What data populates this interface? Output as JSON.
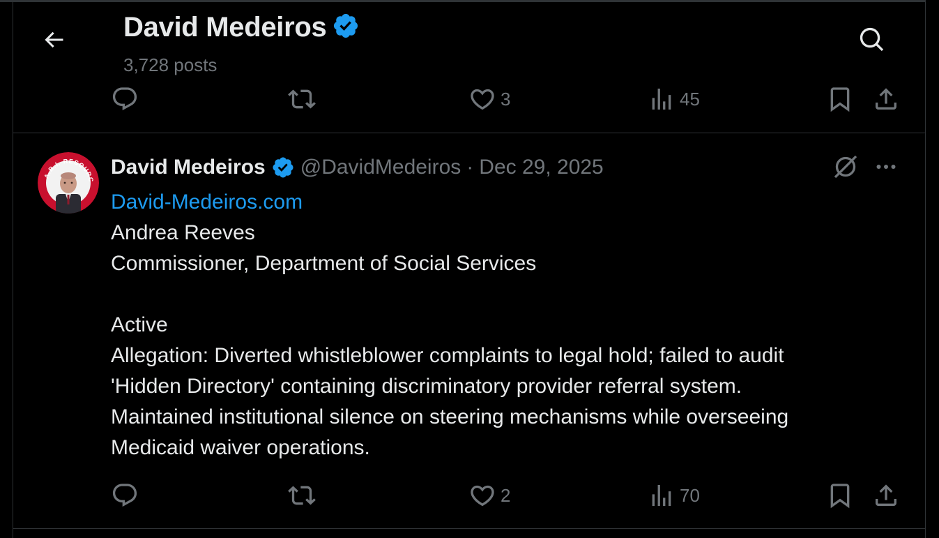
{
  "header": {
    "title": "David Medeiros",
    "posts_count": "3,728 posts"
  },
  "previous_post": {
    "actions": {
      "reply_count": "",
      "repost_count": "",
      "like_count": "3",
      "views_count": "45"
    }
  },
  "post": {
    "author_name": "David Medeiros",
    "handle": "@DavidMedeiros",
    "separator": "·",
    "date": "Dec 29, 2025",
    "link_text": "David-Medeiros.com",
    "body_lines": [
      "Andrea Reeves",
      "Commissioner, Department of Social Services",
      "",
      "Active",
      "Allegation: Diverted whistleblower complaints to legal hold; failed to audit",
      "'Hidden Directory' containing discriminatory provider referral system.",
      "Maintained institutional silence on steering mechanisms while overseeing",
      "Medicaid waiver operations."
    ],
    "actions": {
      "reply_count": "",
      "repost_count": "",
      "like_count": "2",
      "views_count": "70"
    }
  },
  "icons": {
    "back": "arrow-left-icon",
    "search": "search-icon",
    "verified": "verified-badge-icon",
    "reply": "reply-icon",
    "repost": "repost-icon",
    "like": "heart-icon",
    "views": "views-icon",
    "bookmark": "bookmark-icon",
    "share": "share-icon",
    "grok": "grok-icon",
    "more": "more-icon"
  },
  "colors": {
    "background": "#000000",
    "text": "#e7e9ea",
    "muted": "#71767b",
    "link": "#1d9bf0",
    "verified": "#1d9bf0",
    "divider": "#2f3336"
  }
}
